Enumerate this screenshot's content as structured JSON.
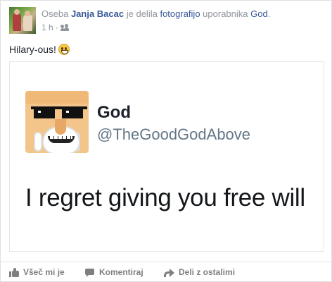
{
  "header": {
    "prefix": "Oseba",
    "author": "Janja Bacac",
    "middle": "je delila",
    "object_link": "fotografijo",
    "object_owner_prefix": "uporabnika",
    "owner": "God",
    "owner_suffix": ".",
    "timestamp": "1 h",
    "separator": "·",
    "audience_icon": "friends-icon"
  },
  "post": {
    "text": "Hilary-ous!",
    "emoji_icon": "smiley-icon"
  },
  "shared_image": {
    "name": "God",
    "handle": "@TheGoodGodAbove",
    "tweet": "I regret giving you free will"
  },
  "actions": {
    "like_label": "Všeč mi je",
    "comment_label": "Komentiraj",
    "share_label": "Deli z ostalimi"
  },
  "colors": {
    "link": "#365899",
    "meta": "#90949c",
    "action": "#7f7f7f"
  }
}
